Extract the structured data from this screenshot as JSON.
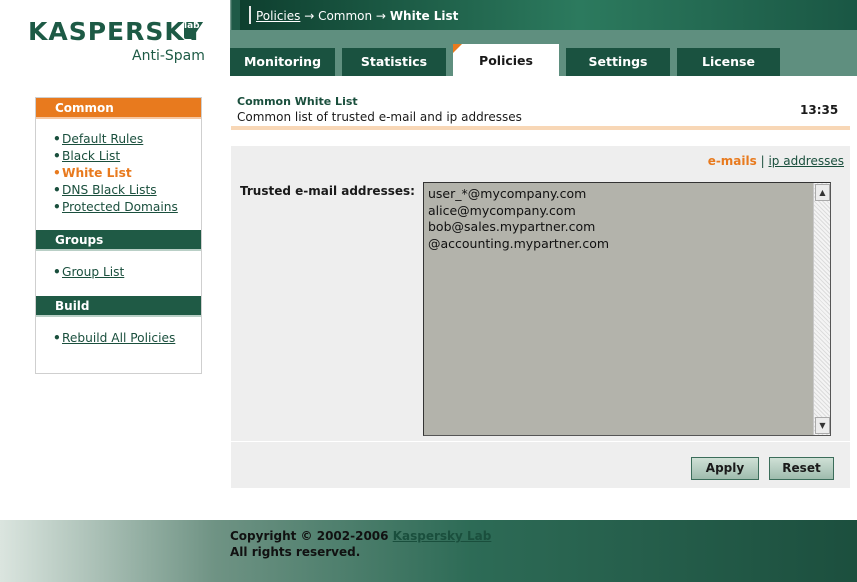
{
  "brand": {
    "logo_text": "KASPERSKY",
    "logo_lab": "lab",
    "product": "Anti-Spam"
  },
  "breadcrumb": {
    "link": "Policies",
    "arrow1": " → Common → ",
    "current": "White List"
  },
  "tabs": [
    {
      "label": "Monitoring"
    },
    {
      "label": "Statistics"
    },
    {
      "label": "Policies",
      "active": true
    },
    {
      "label": "Settings"
    },
    {
      "label": "License"
    }
  ],
  "sidebar": {
    "common_title": "Common",
    "common_items": [
      {
        "label": "Default Rules"
      },
      {
        "label": "Black List"
      },
      {
        "label": "White List",
        "active": true
      },
      {
        "label": "DNS Black Lists"
      },
      {
        "label": "Protected Domains"
      }
    ],
    "groups_title": "Groups",
    "groups_items": [
      {
        "label": "Group List"
      }
    ],
    "build_title": "Build",
    "build_items": [
      {
        "label": "Rebuild All Policies"
      }
    ]
  },
  "main": {
    "title": "Common White List",
    "subtitle": "Common list of trusted e-mail and ip addresses",
    "clock": "13:35",
    "toggle_current": "e-mails",
    "toggle_sep": " | ",
    "toggle_other": "ip addresses",
    "field_label": "Trusted e-mail addresses:",
    "addresses": [
      "user_*@mycompany.com",
      "alice@mycompany.com",
      "bob@sales.mypartner.com",
      "@accounting.mypartner.com"
    ],
    "apply_label": "Apply",
    "reset_label": "Reset"
  },
  "footer": {
    "copyright_prefix": "Copyright © 2002-2006 ",
    "company_link": "Kaspersky Lab",
    "rights": "All rights reserved."
  },
  "colors": {
    "brand_green": "#1a4f3d",
    "accent_orange": "#e87a1e"
  }
}
